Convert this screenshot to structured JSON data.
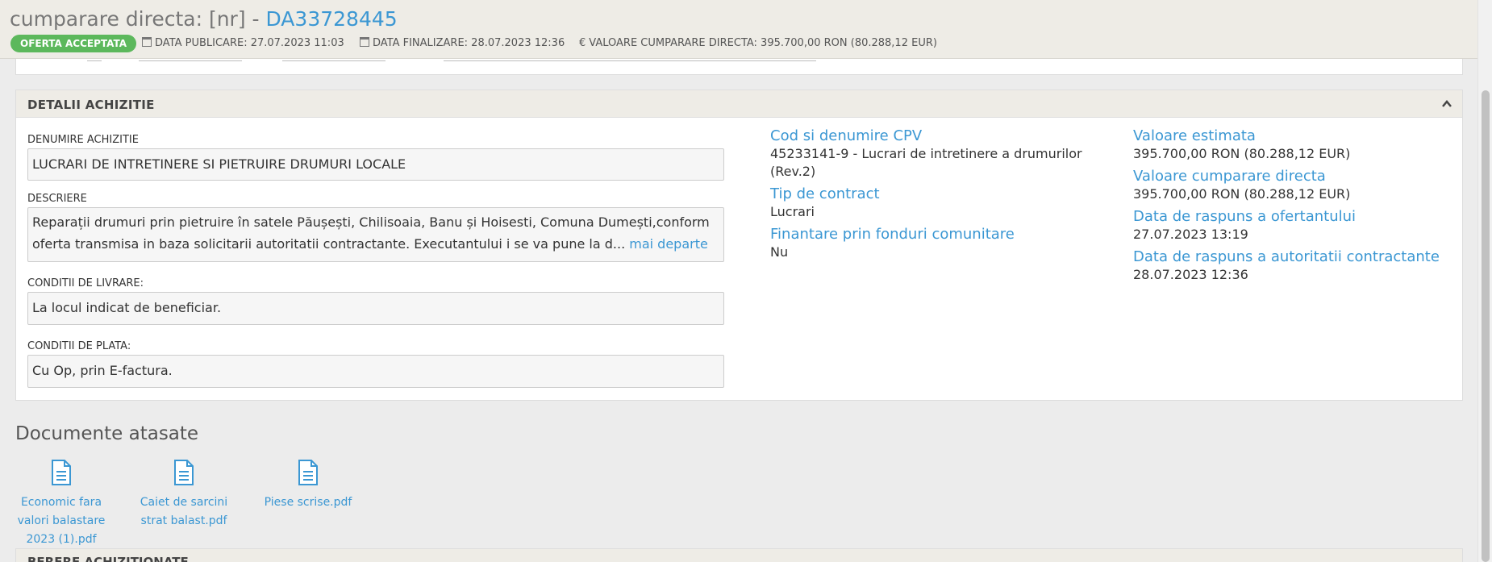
{
  "header": {
    "title_prefix": "cumparare directa: [nr] - ",
    "title_code": "DA33728445",
    "status_badge": "OFERTA ACCEPTATA",
    "data_publicare": "DATA PUBLICARE: 27.07.2023 11:03",
    "data_finalizare": "DATA FINALIZARE: 28.07.2023 12:36",
    "valoare": "VALOARE CUMPARARE DIRECTA: 395.700,00  RON (80.288,12  EUR)",
    "euro_symbol": "€"
  },
  "details": {
    "panel_title": "DETALII ACHIZITIE",
    "denumire_label": "DENUMIRE ACHIZITIE",
    "denumire_value": "LUCRARI DE INTRETINERE SI PIETRUIRE DRUMURI LOCALE",
    "descriere_label": "DESCRIERE",
    "descriere_value": "Reparații drumuri prin pietruire în satele Păușești, Chilisoaia, Banu și Hoisesti, Comuna Dumești,conform oferta transmisa in baza solicitarii autoritatii contractante. Executantului i se va pune la d...",
    "more_link": "mai departe",
    "livrare_label": "CONDITII DE LIVRARE:",
    "livrare_value": "La locul indicat de beneficiar.",
    "plata_label": "CONDITII DE PLATA:",
    "plata_value": "Cu Op, prin E-factura.",
    "middle": [
      {
        "key": "Cod si denumire CPV",
        "value": "45233141-9 - Lucrari de intretinere a drumurilor (Rev.2)"
      },
      {
        "key": "Tip de contract",
        "value": "Lucrari"
      },
      {
        "key": "Finantare prin fonduri comunitare",
        "value": "Nu"
      }
    ],
    "right": [
      {
        "key": "Valoare estimata",
        "value": "395.700,00  RON (80.288,12  EUR)"
      },
      {
        "key": "Valoare cumparare directa",
        "value": "395.700,00  RON (80.288,12  EUR)"
      },
      {
        "key": "Data de raspuns a ofertantului",
        "value": "27.07.2023 13:19"
      },
      {
        "key": "Data de raspuns a autoritatii contractante",
        "value": "28.07.2023 12:36"
      }
    ]
  },
  "documents": {
    "title": "Documente atasate",
    "items": [
      {
        "name": "Economic fara valori balastare 2023 (1).pdf"
      },
      {
        "name": "Caiet de sarcini strat balast.pdf"
      },
      {
        "name": "Piese scrise.pdf"
      }
    ]
  },
  "bottom_panel": {
    "title": "BERERE ACHIZITIONATE"
  }
}
